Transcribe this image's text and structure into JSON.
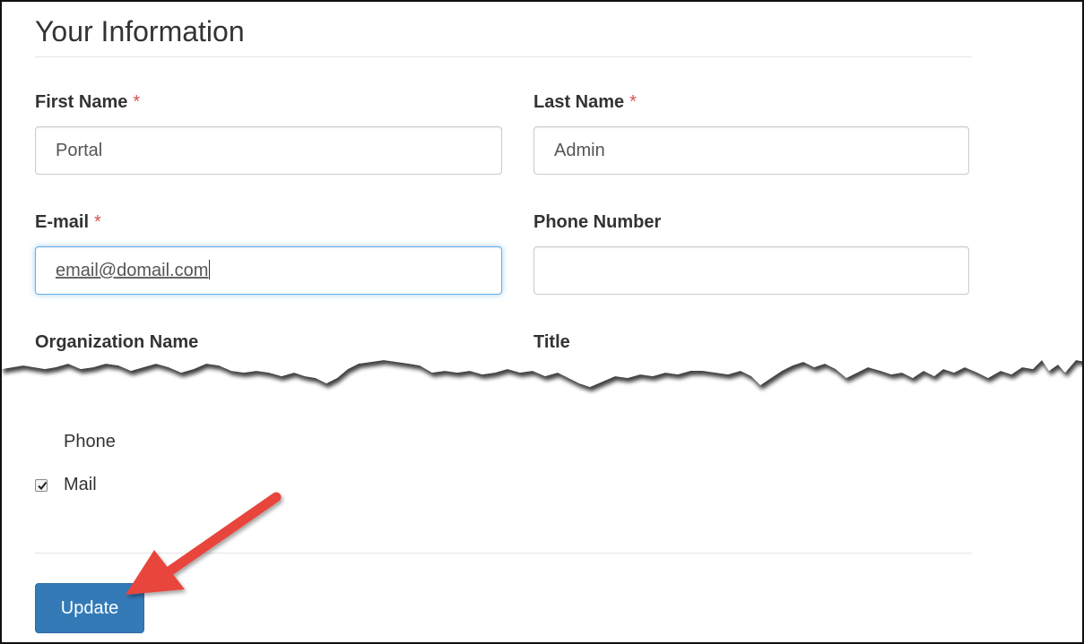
{
  "section": {
    "title": "Your Information"
  },
  "fields": {
    "first_name": {
      "label": "First Name",
      "required_mark": "*",
      "value": "Portal"
    },
    "last_name": {
      "label": "Last Name",
      "required_mark": "*",
      "value": "Admin"
    },
    "email": {
      "label": "E-mail",
      "required_mark": "*",
      "value": "email@domail.com"
    },
    "phone": {
      "label": "Phone Number",
      "value": ""
    },
    "organization": {
      "label": "Organization Name"
    },
    "title": {
      "label": "Title"
    }
  },
  "contact_methods": {
    "phone_label": "Phone",
    "mail_label": "Mail",
    "mail_checked": true
  },
  "actions": {
    "update_label": "Update"
  },
  "colors": {
    "primary_button": "#337ab7",
    "required": "#d9534f",
    "focus_border": "#66afe9",
    "annotation_arrow": "#e8453c"
  },
  "icons": {
    "checkbox": "checkbox-checked-icon",
    "annotation": "red-arrow-icon"
  }
}
